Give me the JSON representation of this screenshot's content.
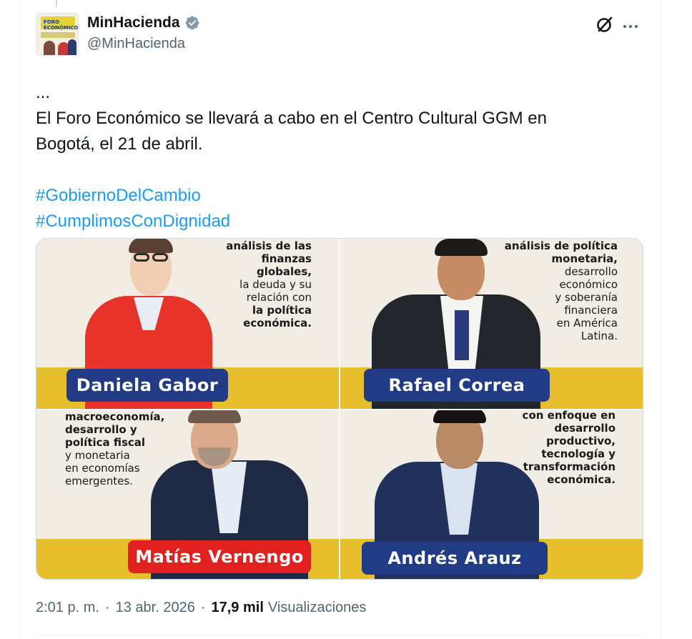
{
  "account": {
    "display_name": "MinHacienda",
    "handle": "@MinHacienda",
    "verified_icon": "verified-badge-icon",
    "verified_color": "#829aab",
    "avatar_text": "FORO ECONÓMICO"
  },
  "tweet": {
    "lines": [
      "...",
      "El Foro Económico se llevará a cabo en el Centro Cultural GGM en",
      "Bogotá, el 21 de abril."
    ],
    "hashtags": [
      "#GobiernoDelCambio",
      "#CumplimosConDignidad"
    ]
  },
  "media": {
    "panels": [
      {
        "name": "Daniela Gabor",
        "desc": [
          "análisis de las",
          "finanzas",
          "globales,",
          "la deuda y su",
          "relación con",
          "la política",
          "económica."
        ],
        "tag_color": "#213c84"
      },
      {
        "name": "Rafael Correa",
        "desc": [
          "análisis de política",
          "monetaria,",
          "desarrollo",
          "económico",
          "y soberanía",
          "financiera",
          "en América",
          "Latina."
        ],
        "tag_color": "#213c84"
      },
      {
        "name": "Matías Vernengo",
        "desc": [
          "macroeconomía,",
          "desarrollo y",
          "política fiscal",
          "y monetaria",
          "en economías",
          "emergentes."
        ],
        "tag_color": "#e0211f"
      },
      {
        "name": "Andrés Arauz",
        "desc": [
          "con enfoque en",
          "desarrollo",
          "productivo,",
          "tecnología y",
          "transformación",
          "económica."
        ],
        "tag_color": "#213c84"
      }
    ]
  },
  "meta": {
    "time": "2:01 p. m.",
    "date": "13 abr. 2026",
    "views_count": "17,9 mil",
    "views_label": "Visualizaciones",
    "separator": "·"
  },
  "icons": {
    "grok": "grok-icon",
    "more": "more-options-icon"
  },
  "colors": {
    "hashtag": "#1d9bf0",
    "secondary_text": "#536471",
    "yellow_band": "#e7bf2d"
  }
}
